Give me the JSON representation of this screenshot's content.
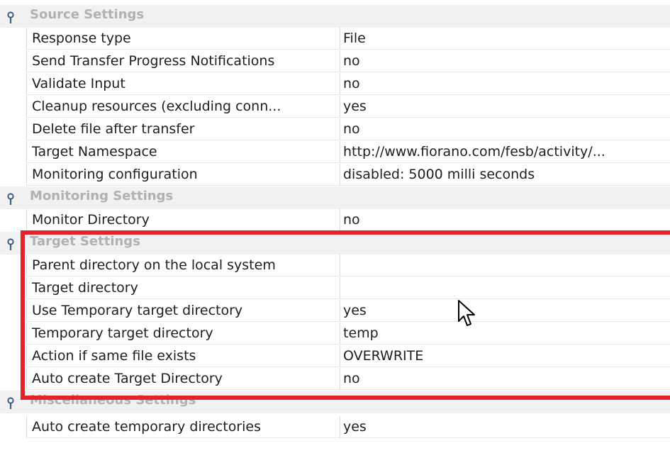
{
  "property_sheet": {
    "sections": [
      {
        "title": "Source Settings",
        "icon": "pin-icon",
        "rows": [
          {
            "name": "Response type",
            "value": "File"
          },
          {
            "name": "Send Transfer Progress Notifications",
            "value": "no"
          },
          {
            "name": "Validate Input",
            "value": "no"
          },
          {
            "name": "Cleanup resources (excluding conn...",
            "value": "yes"
          },
          {
            "name": "Delete file after transfer",
            "value": "no"
          },
          {
            "name": "Target Namespace",
            "value": "http://www.fiorano.com/fesb/activity/..."
          },
          {
            "name": "Monitoring configuration",
            "value": "disabled: 5000 milli seconds"
          }
        ]
      },
      {
        "title": "Monitoring Settings",
        "icon": "pin-icon",
        "rows": [
          {
            "name": "Monitor Directory",
            "value": "no"
          }
        ]
      },
      {
        "title": "Target Settings",
        "icon": "pin-icon",
        "rows": [
          {
            "name": "Parent directory on the local system",
            "value": ""
          },
          {
            "name": "Target directory",
            "value": ""
          },
          {
            "name": "Use Temporary target directory",
            "value": "yes"
          },
          {
            "name": "Temporary target directory",
            "value": "temp"
          },
          {
            "name": "Action if same file exists",
            "value": "OVERWRITE"
          },
          {
            "name": "Auto create Target Directory",
            "value": "no"
          }
        ]
      },
      {
        "title": "Miscellaneous Settings",
        "icon": "pin-icon",
        "rows": [
          {
            "name": "Auto create temporary directories",
            "value": "yes"
          }
        ]
      }
    ]
  },
  "annotation": {
    "highlight_color": "#e3232a",
    "highlighted_section": "Target Settings"
  },
  "cursor": {
    "icon": "mouse-pointer-icon"
  }
}
